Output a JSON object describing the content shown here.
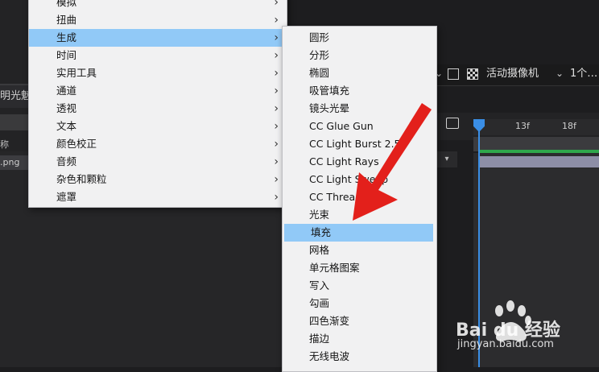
{
  "background": {
    "left_tab_text": "明光魅",
    "left_column_text": "称",
    "left_row_text": ".png",
    "dropdown_glyph": "▾",
    "camera_label": "活动摄像机",
    "view_label": "1个…",
    "chevron": "⌄",
    "ruler_ticks": [
      "13f",
      "18f"
    ]
  },
  "main_menu": {
    "items": [
      {
        "label": "模拟",
        "has_sub": true,
        "highlight": false
      },
      {
        "label": "扭曲",
        "has_sub": true,
        "highlight": false
      },
      {
        "label": "生成",
        "has_sub": true,
        "highlight": true
      },
      {
        "label": "时间",
        "has_sub": true,
        "highlight": false
      },
      {
        "label": "实用工具",
        "has_sub": true,
        "highlight": false
      },
      {
        "label": "通道",
        "has_sub": true,
        "highlight": false
      },
      {
        "label": "透视",
        "has_sub": true,
        "highlight": false
      },
      {
        "label": "文本",
        "has_sub": true,
        "highlight": false
      },
      {
        "label": "颜色校正",
        "has_sub": true,
        "highlight": false
      },
      {
        "label": "音频",
        "has_sub": true,
        "highlight": false
      },
      {
        "label": "杂色和颗粒",
        "has_sub": true,
        "highlight": false
      },
      {
        "label": "遮罩",
        "has_sub": true,
        "highlight": false
      }
    ],
    "arrow_glyph": "›"
  },
  "sub_menu": {
    "items": [
      {
        "label": "圆形",
        "highlight": false
      },
      {
        "label": "分形",
        "highlight": false
      },
      {
        "label": "椭圆",
        "highlight": false
      },
      {
        "label": "吸管填充",
        "highlight": false
      },
      {
        "label": "镜头光晕",
        "highlight": false
      },
      {
        "label": "CC Glue Gun",
        "highlight": false
      },
      {
        "label": "CC Light Burst 2.5",
        "highlight": false
      },
      {
        "label": "CC Light Rays",
        "highlight": false
      },
      {
        "label": "CC Light Sweep",
        "highlight": false
      },
      {
        "label": "CC Threads",
        "highlight": false
      },
      {
        "label": "光束",
        "highlight": false
      },
      {
        "label": "填充",
        "highlight": true
      },
      {
        "label": "网格",
        "highlight": false
      },
      {
        "label": "单元格图案",
        "highlight": false
      },
      {
        "label": "写入",
        "highlight": false
      },
      {
        "label": "勾画",
        "highlight": false
      },
      {
        "label": "四色渐变",
        "highlight": false
      },
      {
        "label": "描边",
        "highlight": false
      },
      {
        "label": "无线电波",
        "highlight": false
      }
    ]
  },
  "watermark": {
    "logo_text": "Bai du 经验",
    "url": "jingyan.baidu.com"
  },
  "colors": {
    "menu_bg": "#f1f1f2",
    "highlight": "#91c9f7",
    "annotation_red": "#e3201b",
    "playhead_blue": "#3a8ee6",
    "layer_bar": "#8d8ea6"
  }
}
